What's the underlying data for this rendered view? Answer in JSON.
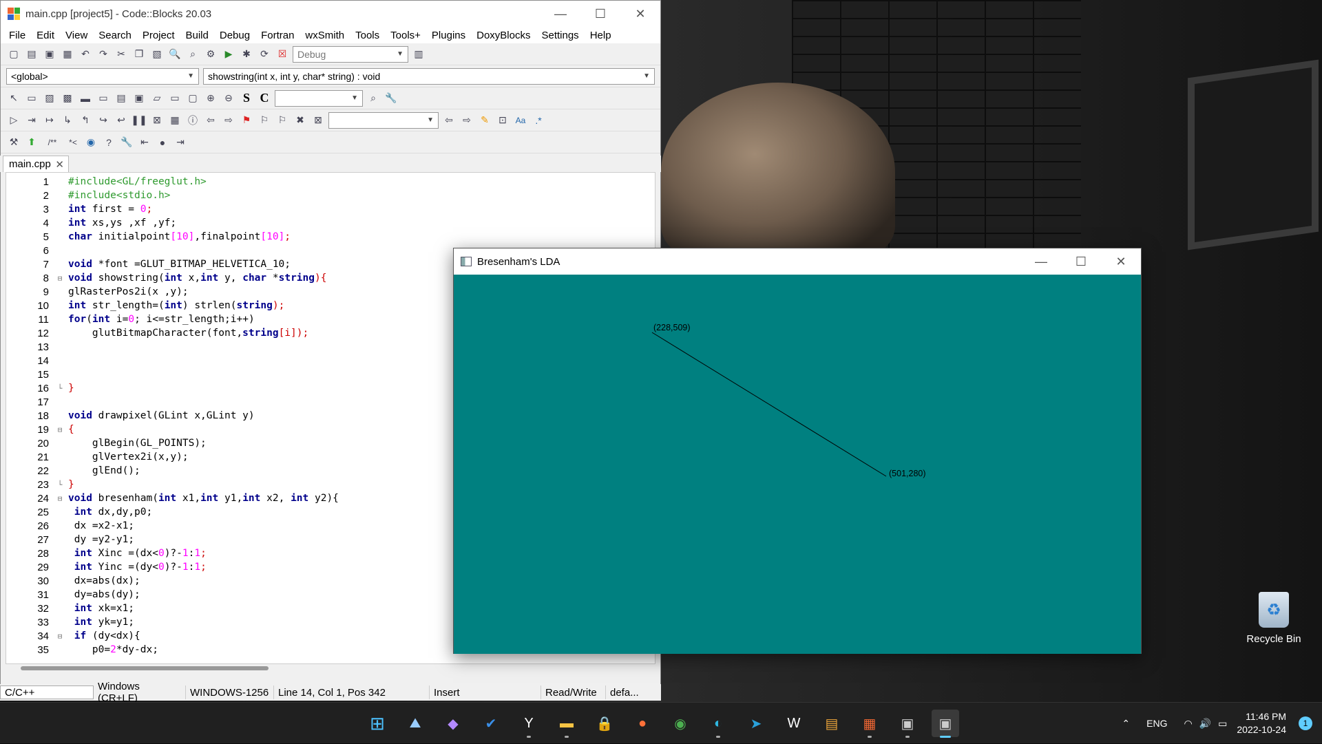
{
  "codeblocks": {
    "title": "main.cpp [project5] - Code::Blocks 20.03",
    "menu": [
      "File",
      "Edit",
      "View",
      "Search",
      "Project",
      "Build",
      "Debug",
      "Fortran",
      "wxSmith",
      "Tools",
      "Tools+",
      "Plugins",
      "DoxyBlocks",
      "Settings",
      "Help"
    ],
    "build_target": "Debug",
    "scope": "<global>",
    "function": "showstring(int x, int y, char* string) : void",
    "tab": "main.cpp",
    "code_lines": [
      {
        "n": "1",
        "fold": "",
        "parts": [
          {
            "t": "#include<GL/freeglut.h>",
            "c": "#2e9a2e"
          }
        ]
      },
      {
        "n": "2",
        "fold": "",
        "parts": [
          {
            "t": "#include<stdio.h>",
            "c": "#2e9a2e"
          }
        ]
      },
      {
        "n": "3",
        "fold": "",
        "parts": [
          {
            "t": "int",
            "c": "#00008b",
            "b": true
          },
          {
            "t": " first = ",
            "c": "#000"
          },
          {
            "t": "0",
            "c": "#f0f"
          },
          {
            "t": ";",
            "c": "#c00"
          }
        ]
      },
      {
        "n": "4",
        "fold": "",
        "parts": [
          {
            "t": "int",
            "c": "#00008b",
            "b": true
          },
          {
            "t": " xs,ys ,xf ,yf;",
            "c": "#000"
          }
        ]
      },
      {
        "n": "5",
        "fold": "",
        "parts": [
          {
            "t": "char",
            "c": "#00008b",
            "b": true
          },
          {
            "t": " initialpoint",
            "c": "#000"
          },
          {
            "t": "[10]",
            "c": "#f0f"
          },
          {
            "t": ",finalpoint",
            "c": "#000"
          },
          {
            "t": "[10]",
            "c": "#f0f"
          },
          {
            "t": ";",
            "c": "#c00"
          }
        ]
      },
      {
        "n": "6",
        "fold": "",
        "parts": [
          {
            "t": "",
            "c": "#000"
          }
        ]
      },
      {
        "n": "7",
        "fold": "",
        "parts": [
          {
            "t": "void",
            "c": "#00008b",
            "b": true
          },
          {
            "t": " *font =GLUT_BITMAP_HELVETICA_10;",
            "c": "#000"
          }
        ]
      },
      {
        "n": "8",
        "fold": "⊟",
        "parts": [
          {
            "t": "void",
            "c": "#00008b",
            "b": true
          },
          {
            "t": " showstring(",
            "c": "#000"
          },
          {
            "t": "int",
            "c": "#00008b",
            "b": true
          },
          {
            "t": " x,",
            "c": "#000"
          },
          {
            "t": "int",
            "c": "#00008b",
            "b": true
          },
          {
            "t": " y, ",
            "c": "#000"
          },
          {
            "t": "char",
            "c": "#00008b",
            "b": true
          },
          {
            "t": " *",
            "c": "#000"
          },
          {
            "t": "string",
            "c": "#00008b",
            "b": true
          },
          {
            "t": "){",
            "c": "#c00"
          }
        ]
      },
      {
        "n": "9",
        "fold": "",
        "parts": [
          {
            "t": "glRasterPos2i(x ,y);",
            "c": "#000"
          }
        ]
      },
      {
        "n": "10",
        "fold": "",
        "parts": [
          {
            "t": "int",
            "c": "#00008b",
            "b": true
          },
          {
            "t": " str_length=(",
            "c": "#000"
          },
          {
            "t": "int",
            "c": "#00008b",
            "b": true
          },
          {
            "t": ") strlen(",
            "c": "#000"
          },
          {
            "t": "string",
            "c": "#00008b",
            "b": true
          },
          {
            "t": ");",
            "c": "#c00"
          }
        ]
      },
      {
        "n": "11",
        "fold": "",
        "parts": [
          {
            "t": "for",
            "c": "#00008b",
            "b": true
          },
          {
            "t": "(",
            "c": "#000"
          },
          {
            "t": "int",
            "c": "#00008b",
            "b": true
          },
          {
            "t": " i=",
            "c": "#000"
          },
          {
            "t": "0",
            "c": "#f0f"
          },
          {
            "t": "; i<=str_length;i++)",
            "c": "#000"
          }
        ]
      },
      {
        "n": "12",
        "fold": "",
        "parts": [
          {
            "t": "    glutBitmapCharacter(font,",
            "c": "#000"
          },
          {
            "t": "string",
            "c": "#00008b",
            "b": true
          },
          {
            "t": "[i]);",
            "c": "#c00"
          }
        ]
      },
      {
        "n": "13",
        "fold": "",
        "parts": [
          {
            "t": "",
            "c": "#000"
          }
        ]
      },
      {
        "n": "14",
        "fold": "",
        "parts": [
          {
            "t": "",
            "c": "#000"
          }
        ]
      },
      {
        "n": "15",
        "fold": "",
        "parts": [
          {
            "t": "",
            "c": "#000"
          }
        ]
      },
      {
        "n": "16",
        "fold": "└",
        "parts": [
          {
            "t": "}",
            "c": "#c00"
          }
        ]
      },
      {
        "n": "17",
        "fold": "",
        "parts": [
          {
            "t": "",
            "c": "#000"
          }
        ]
      },
      {
        "n": "18",
        "fold": "",
        "parts": [
          {
            "t": "void",
            "c": "#00008b",
            "b": true
          },
          {
            "t": " drawpixel(GLint x,GLint y)",
            "c": "#000"
          }
        ]
      },
      {
        "n": "19",
        "fold": "⊟",
        "parts": [
          {
            "t": "{",
            "c": "#c00"
          }
        ]
      },
      {
        "n": "20",
        "fold": "",
        "parts": [
          {
            "t": "    glBegin(GL_POINTS);",
            "c": "#000"
          }
        ]
      },
      {
        "n": "21",
        "fold": "",
        "parts": [
          {
            "t": "    glVertex2i(x,y);",
            "c": "#000"
          }
        ]
      },
      {
        "n": "22",
        "fold": "",
        "parts": [
          {
            "t": "    glEnd();",
            "c": "#000"
          }
        ]
      },
      {
        "n": "23",
        "fold": "└",
        "parts": [
          {
            "t": "}",
            "c": "#c00"
          }
        ]
      },
      {
        "n": "24",
        "fold": "⊟",
        "parts": [
          {
            "t": "void",
            "c": "#00008b",
            "b": true
          },
          {
            "t": " bresenham(",
            "c": "#000"
          },
          {
            "t": "int",
            "c": "#00008b",
            "b": true
          },
          {
            "t": " x1,",
            "c": "#000"
          },
          {
            "t": "int",
            "c": "#00008b",
            "b": true
          },
          {
            "t": " y1,",
            "c": "#000"
          },
          {
            "t": "int",
            "c": "#00008b",
            "b": true
          },
          {
            "t": " x2, ",
            "c": "#000"
          },
          {
            "t": "int",
            "c": "#00008b",
            "b": true
          },
          {
            "t": " y2){",
            "c": "#000"
          }
        ]
      },
      {
        "n": "25",
        "fold": "",
        "parts": [
          {
            "t": " int",
            "c": "#00008b",
            "b": true
          },
          {
            "t": " dx,dy,p0;",
            "c": "#000"
          }
        ]
      },
      {
        "n": "26",
        "fold": "",
        "parts": [
          {
            "t": " dx =x2-x1;",
            "c": "#000"
          }
        ]
      },
      {
        "n": "27",
        "fold": "",
        "parts": [
          {
            "t": " dy =y2-y1;",
            "c": "#000"
          }
        ]
      },
      {
        "n": "28",
        "fold": "",
        "parts": [
          {
            "t": " int",
            "c": "#00008b",
            "b": true
          },
          {
            "t": " Xinc =(dx<",
            "c": "#000"
          },
          {
            "t": "0",
            "c": "#f0f"
          },
          {
            "t": ")?-",
            "c": "#000"
          },
          {
            "t": "1",
            "c": "#f0f"
          },
          {
            "t": ":",
            "c": "#000"
          },
          {
            "t": "1",
            "c": "#f0f"
          },
          {
            "t": ";",
            "c": "#c00"
          }
        ]
      },
      {
        "n": "29",
        "fold": "",
        "parts": [
          {
            "t": " int",
            "c": "#00008b",
            "b": true
          },
          {
            "t": " Yinc =(dy<",
            "c": "#000"
          },
          {
            "t": "0",
            "c": "#f0f"
          },
          {
            "t": ")?-",
            "c": "#000"
          },
          {
            "t": "1",
            "c": "#f0f"
          },
          {
            "t": ":",
            "c": "#000"
          },
          {
            "t": "1",
            "c": "#f0f"
          },
          {
            "t": ";",
            "c": "#c00"
          }
        ]
      },
      {
        "n": "30",
        "fold": "",
        "parts": [
          {
            "t": " dx=abs(dx);",
            "c": "#000"
          }
        ]
      },
      {
        "n": "31",
        "fold": "",
        "parts": [
          {
            "t": " dy=abs(dy);",
            "c": "#000"
          }
        ]
      },
      {
        "n": "32",
        "fold": "",
        "parts": [
          {
            "t": " int",
            "c": "#00008b",
            "b": true
          },
          {
            "t": " xk=x1;",
            "c": "#000"
          }
        ]
      },
      {
        "n": "33",
        "fold": "",
        "parts": [
          {
            "t": " int",
            "c": "#00008b",
            "b": true
          },
          {
            "t": " yk=y1;",
            "c": "#000"
          }
        ]
      },
      {
        "n": "34",
        "fold": "⊟",
        "parts": [
          {
            "t": " if",
            "c": "#00008b",
            "b": true
          },
          {
            "t": " (dy<dx){",
            "c": "#000"
          }
        ]
      },
      {
        "n": "35",
        "fold": "",
        "parts": [
          {
            "t": "    p0=",
            "c": "#000"
          },
          {
            "t": "2",
            "c": "#f0f"
          },
          {
            "t": "*dy-dx;",
            "c": "#000"
          }
        ]
      }
    ],
    "status": {
      "language": "C/C++",
      "eol": "Windows (CR+LF)",
      "encoding": "WINDOWS-1256",
      "position": "Line 14, Col 1, Pos 342",
      "mode": "Insert",
      "access": "Read/Write",
      "profile": "defa..."
    }
  },
  "glwindow": {
    "title": "Bresenham's LDA",
    "background": "#008080",
    "start_label": "(228,509)",
    "end_label": "(501,280)"
  },
  "desktop": {
    "recycle_bin": "Recycle Bin"
  },
  "taskbar": {
    "apps": [
      "windows-start-icon",
      "task-monitor-icon",
      "visual-studio-icon",
      "todo-icon",
      "yandex-icon",
      "file-explorer-icon",
      "vpn-icon",
      "firefox-icon",
      "chrome-icon",
      "edge-icon",
      "telegram-icon",
      "word-icon",
      "game-icon",
      "codeblocks-icon",
      "opengl-app-icon",
      "active-app-icon"
    ],
    "language": "ENG",
    "time": "11:46 PM",
    "date": "2022-10-24",
    "notifications": "1"
  }
}
